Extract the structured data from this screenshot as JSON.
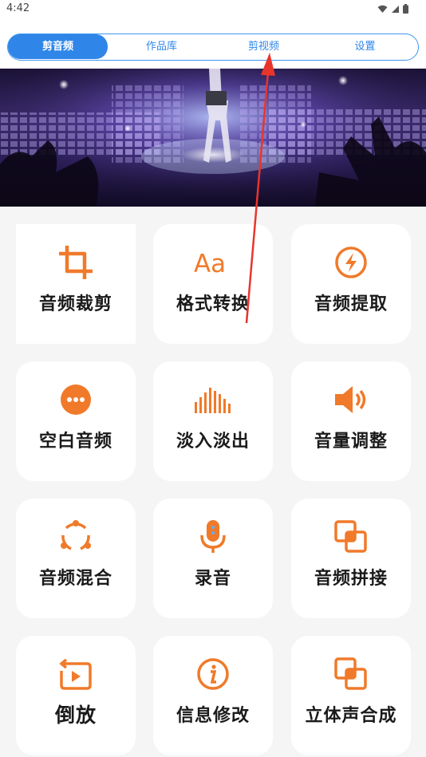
{
  "status_bar": {
    "time": "4:42"
  },
  "tabs": [
    {
      "label": "剪音频",
      "active": true
    },
    {
      "label": "作品库",
      "active": false
    },
    {
      "label": "剪视频",
      "active": false
    },
    {
      "label": "设置",
      "active": false
    }
  ],
  "colors": {
    "accent": "#2f86e8",
    "icon_orange": "#f07a2a",
    "card_bg": "#ffffff",
    "page_bg": "#f5f5f5"
  },
  "features": [
    {
      "label": "音频裁剪",
      "icon": "crop-icon"
    },
    {
      "label": "格式转换",
      "icon": "font-aa-icon"
    },
    {
      "label": "音频提取",
      "icon": "lightning-circle-icon"
    },
    {
      "label": "空白音频",
      "icon": "more-dots-icon"
    },
    {
      "label": "淡入淡出",
      "icon": "equalizer-bars-icon"
    },
    {
      "label": "音量调整",
      "icon": "speaker-volume-icon"
    },
    {
      "label": "音频混合",
      "icon": "share-cycle-icon"
    },
    {
      "label": "录音",
      "icon": "microphone-icon"
    },
    {
      "label": "音频拼接",
      "icon": "overlap-squares-icon"
    },
    {
      "label": "倒放",
      "icon": "reverse-play-icon"
    },
    {
      "label": "信息修改",
      "icon": "info-circle-icon"
    },
    {
      "label": "立体声合成",
      "icon": "overlap-squares-icon"
    }
  ]
}
